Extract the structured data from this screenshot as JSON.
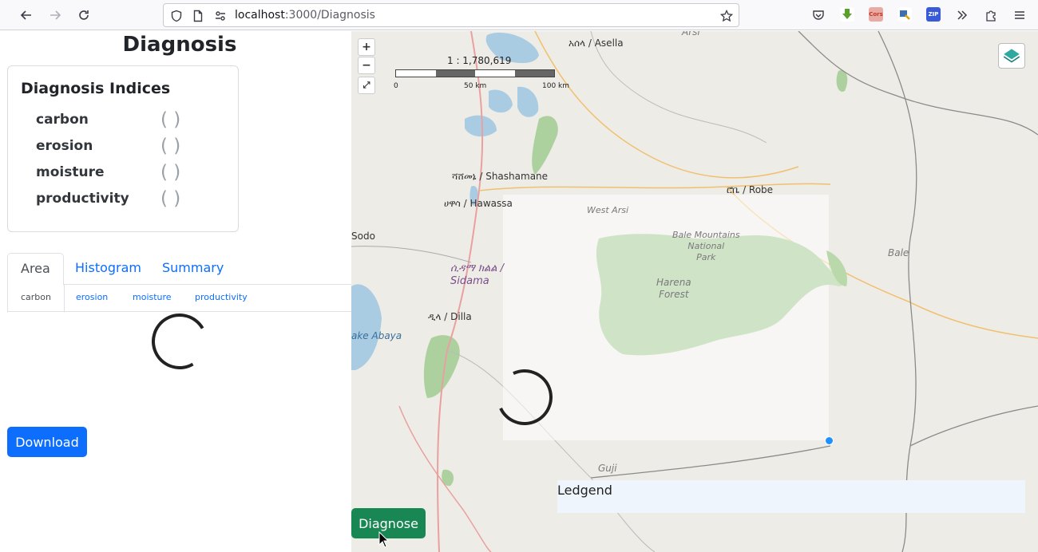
{
  "browser": {
    "url_host": "localhost",
    "url_path": ":3000/Diagnosis"
  },
  "page": {
    "title": "Diagnosis",
    "indices_title": "Diagnosis Indices",
    "indices": [
      {
        "label": "carbon",
        "value": "(   )"
      },
      {
        "label": "erosion",
        "value": "(   )"
      },
      {
        "label": "moisture",
        "value": "(   )"
      },
      {
        "label": "productivity",
        "value": "(   )"
      }
    ],
    "tabs": [
      "Area",
      "Histogram",
      "Summary"
    ],
    "active_tab": "Area",
    "subtabs": [
      "carbon",
      "erosion",
      "moisture",
      "productivity"
    ],
    "active_subtab": "carbon",
    "download_label": "Download"
  },
  "map": {
    "zoom_in": "+",
    "zoom_out": "−",
    "fullscreen": "⤢",
    "scale_ratio": "1 : 1,780,619",
    "scale_labels": [
      "0",
      "50 km",
      "100 km"
    ],
    "places": {
      "asella": "አሰላ / Asella",
      "arsi": "Arsi",
      "shashamane": "ሻሸመኔ / Shashamane",
      "hawassa": "ሀዋሳ / Hawassa",
      "robe": "ሮቤ / Robe",
      "west_arsi": "West Arsi",
      "bale_mountains": "Bale Mountains\nNational\nPark",
      "harena": "Harena\nForest",
      "sodo": "Sodo",
      "bale": "Bale",
      "sidama": "ሲዳማ ክልል /\nSidama",
      "dilla": "ዲላ / Dilla",
      "abaya": "ake Abaya",
      "guji": "Guji"
    },
    "legend_title": "Ledgend",
    "diagnose_label": "Diagnose",
    "colors": {
      "accent": "#0d6efd",
      "diagnose": "#198754",
      "point": "#1e90ff"
    }
  }
}
